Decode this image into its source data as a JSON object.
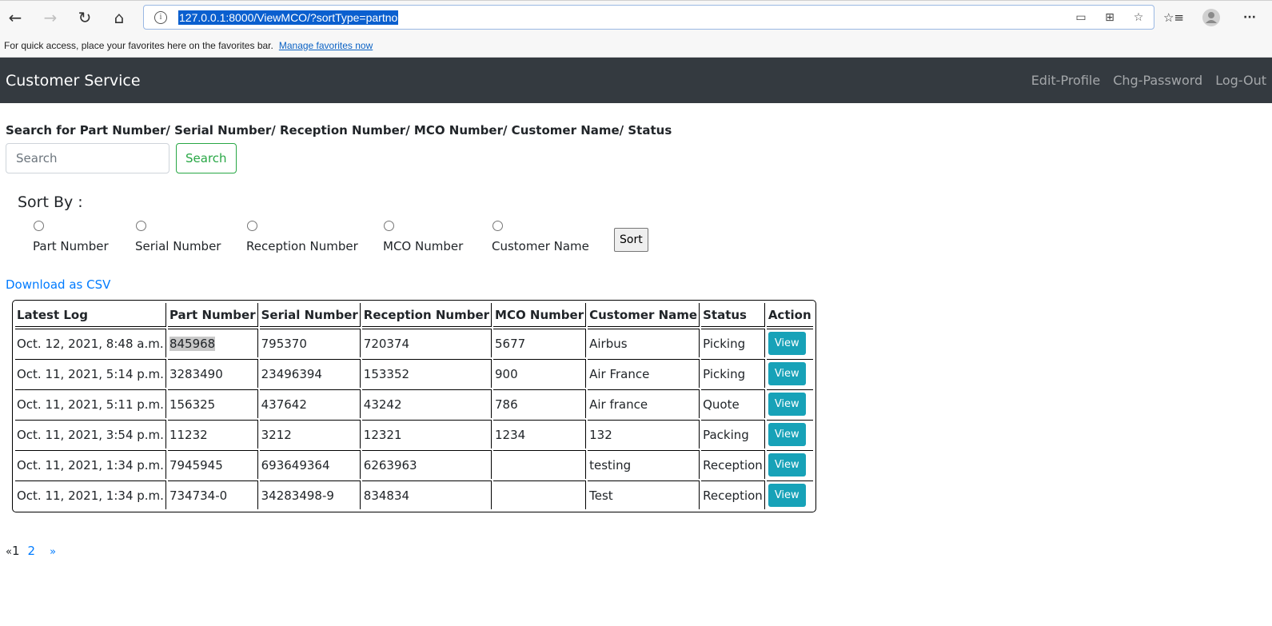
{
  "browser": {
    "url": "127.0.0.1:8000/ViewMCO/?sortType=partno",
    "favorites_bar_text": "For quick access, place your favorites here on the favorites bar.",
    "favorites_bar_link": "Manage favorites now",
    "icons": {
      "back": "←",
      "forward": "→",
      "refresh": "↻",
      "home": "⌂",
      "info": "i",
      "device": "▭",
      "apps": "⊞",
      "add_favorite": "☆",
      "favorites": "☆≡",
      "more": "···"
    }
  },
  "navbar": {
    "brand": "Customer Service",
    "links": [
      "Edit-Profile",
      "Chg-Password",
      "Log-Out"
    ]
  },
  "search": {
    "label": "Search for Part Number/ Serial Number/ Reception Number/ MCO Number/ Customer Name/ Status",
    "placeholder": "Search",
    "value": "",
    "button": "Search"
  },
  "sort": {
    "title": "Sort By :",
    "options": [
      "Part Number",
      "Serial Number",
      "Reception Number",
      "MCO Number",
      "Customer Name"
    ],
    "selected": null,
    "button": "Sort"
  },
  "csv_link": "Download as CSV",
  "table": {
    "headers": [
      "Latest Log",
      "Part Number",
      "Serial Number",
      "Reception Number",
      "MCO Number",
      "Customer Name",
      "Status",
      "Action"
    ],
    "rows": [
      [
        "Oct. 12, 2021, 8:48 a.m.",
        "845968",
        "795370",
        "720374",
        "5677",
        "Airbus",
        "Picking",
        "View"
      ],
      [
        "Oct. 11, 2021, 5:14 p.m.",
        "3283490",
        "23496394",
        "153352",
        "900",
        "Air France",
        "Picking",
        "View"
      ],
      [
        "Oct. 11, 2021, 5:11 p.m.",
        "156325",
        "437642",
        "43242",
        "786",
        "Air france",
        "Quote",
        "View"
      ],
      [
        "Oct. 11, 2021, 3:54 p.m.",
        "11232",
        "3212",
        "12321",
        "1234",
        "132",
        "Packing",
        "View"
      ],
      [
        "Oct. 11, 2021, 1:34 p.m.",
        "7945945",
        "693649364",
        "6263963",
        "",
        "testing",
        "Reception",
        "View"
      ],
      [
        "Oct. 11, 2021, 1:34 p.m.",
        "734734-0",
        "34283498-9",
        "834834",
        "",
        "Test",
        "Reception",
        "View"
      ]
    ],
    "highlighted_cell": "845968"
  },
  "pagination": {
    "prev": "«",
    "current": "1",
    "pages": [
      "2"
    ],
    "next": "»"
  },
  "colors": {
    "navbar_bg": "#343a40",
    "primary_link": "#007bff",
    "success": "#28a745",
    "info_button": "#17a2b8"
  }
}
